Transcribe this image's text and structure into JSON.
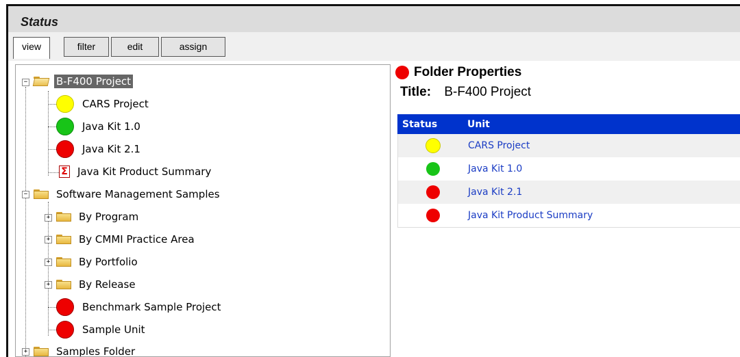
{
  "status_header": {
    "title": "Status"
  },
  "tabs": [
    {
      "label": "view",
      "active": true
    },
    {
      "label": "filter",
      "active": false
    },
    {
      "label": "edit",
      "active": false
    },
    {
      "label": "assign",
      "active": false
    }
  ],
  "tree": {
    "b_f400": {
      "label": "B-F400 Project",
      "children": [
        {
          "label": "CARS Project",
          "status": "yellow"
        },
        {
          "label": "Java Kit 1.0",
          "status": "green"
        },
        {
          "label": "Java Kit 2.1",
          "status": "red"
        },
        {
          "label": "Java Kit Product Summary",
          "icon": "sigma-report-icon"
        }
      ]
    },
    "software_mgmt": {
      "label": "Software Management Samples",
      "children": [
        {
          "label": "By Program"
        },
        {
          "label": "By CMMI Practice Area"
        },
        {
          "label": "By Portfolio"
        },
        {
          "label": "By Release"
        },
        {
          "label": "Benchmark Sample Project",
          "status": "red"
        },
        {
          "label": "Sample Unit",
          "status": "red"
        }
      ]
    },
    "samples_folder": {
      "label": "Samples Folder"
    }
  },
  "properties": {
    "heading": "Folder Properties",
    "title_key": "Title:",
    "title_value": "B-F400 Project",
    "table": {
      "headers": [
        "Status",
        "Unit"
      ],
      "rows": [
        {
          "status": "yellow",
          "unit": "CARS Project"
        },
        {
          "status": "green",
          "unit": "Java Kit 1.0"
        },
        {
          "status": "red",
          "unit": "Java Kit 2.1"
        },
        {
          "status": "red",
          "unit": "Java Kit Product Summary"
        }
      ]
    }
  },
  "colors": {
    "header_blue": "#0033cc",
    "status_red": "#ee0000",
    "status_green": "#18c418",
    "status_yellow": "#ffff00",
    "link_blue": "#1a3cc4"
  }
}
